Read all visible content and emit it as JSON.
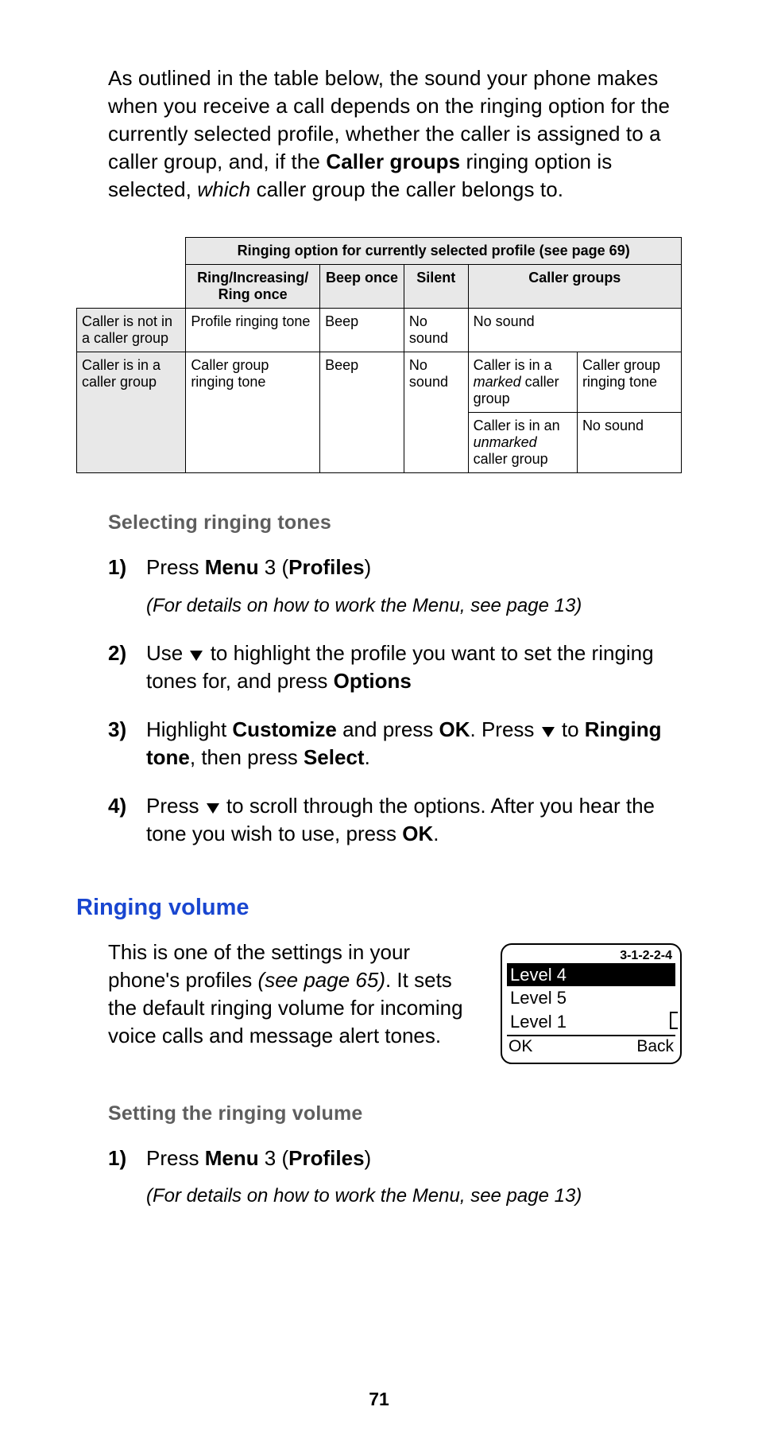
{
  "intro": {
    "p1a": "As outlined in the table below, the sound your phone makes when you receive a call depends on the ringing option for the currently selected profile, whether the caller is assigned to a caller group, and, if the ",
    "p1b_bold": "Caller groups",
    "p1c": " ringing option is selected, ",
    "p1d_italic": "which",
    "p1e": " caller group the caller belongs to."
  },
  "table": {
    "spanHeader": "Ringing option for currently selected profile (see page 69)",
    "cols": {
      "c1a": "Ring/Increasing/",
      "c1b": "Ring once",
      "c2": "Beep once",
      "c3": "Silent",
      "c4": "Caller groups"
    },
    "r1": {
      "head": "Caller is not in a caller group",
      "c1": "Profile ringing tone",
      "c2": "Beep",
      "c3": "No sound",
      "c4": "No sound"
    },
    "r2": {
      "head": "Caller is in a caller group",
      "c1": "Caller group ringing tone",
      "c2": "Beep",
      "c3": "No sound",
      "sub1a": "Caller is in a ",
      "sub1b_italic": "marked",
      "sub1c": " caller group",
      "sub1v": "Caller group ringing tone",
      "sub2a": "Caller is in an ",
      "sub2b_italic": "unmarked",
      "sub2c": " caller group",
      "sub2v": "No sound"
    }
  },
  "sec1": {
    "heading": "Selecting ringing tones",
    "s1": {
      "num": "1)",
      "a": "Press ",
      "b_bold": "Menu",
      "c": " 3 (",
      "d_bold": "Profiles",
      "e": ")",
      "note": "(For details on how to work the Menu, see page 13)"
    },
    "s2": {
      "num": "2)",
      "a": "Use ",
      "b": " to highlight the profile you want to set the ringing tones for, and press ",
      "c_bold": "Options"
    },
    "s3": {
      "num": "3)",
      "a": "Highlight ",
      "b_bold": "Customize",
      "c": " and press ",
      "d_bold": "OK",
      "e": ". Press ",
      "f": " to ",
      "g_bold": "Ringing tone",
      "h": ", then press ",
      "i_bold": "Select",
      "j": "."
    },
    "s4": {
      "num": "4)",
      "a": "Press ",
      "b": " to scroll through the options. After you hear the tone you wish to use, press ",
      "c_bold": "OK",
      "d": "."
    }
  },
  "sec2": {
    "heading": "Ringing volume",
    "para": {
      "a": "This is one of the settings in your phone's profiles ",
      "b_italic": "(see page 65)",
      "c": ". It sets the default ringing volume for incoming voice calls and message alert tones."
    },
    "phone": {
      "menucode": "3-1-2-2-4",
      "opt1": "Level 4",
      "opt2": "Level 5",
      "opt3": "Level 1",
      "left": "OK",
      "right": "Back"
    },
    "sub": "Setting the ringing volume",
    "s1": {
      "num": "1)",
      "a": "Press ",
      "b_bold": "Menu",
      "c": " 3 (",
      "d_bold": "Profiles",
      "e": ")",
      "note": "(For details on how to work the Menu, see page 13)"
    }
  },
  "pageNumber": "71"
}
